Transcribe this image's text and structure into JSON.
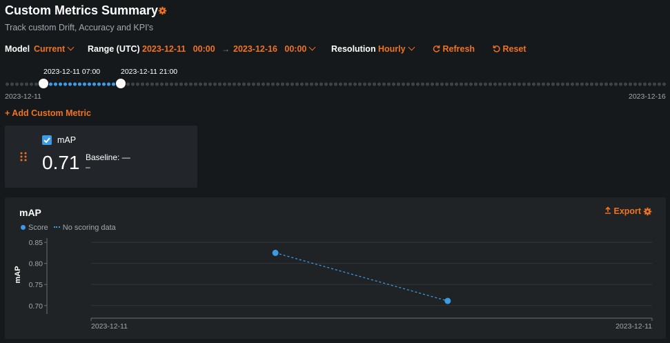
{
  "header": {
    "title": "Custom Metrics Summary",
    "subtitle": "Track custom Drift, Accuracy and KPI's",
    "settings_icon": "gear-icon"
  },
  "controls": {
    "model_label": "Model",
    "model_value": "Current",
    "range_label": "Range (UTC)",
    "range_start_date": "2023-12-11",
    "range_start_time": "00:00",
    "range_end_date": "2023-12-16",
    "range_end_time": "00:00",
    "resolution_label": "Resolution",
    "resolution_value": "Hourly",
    "refresh_label": "Refresh",
    "reset_label": "Reset"
  },
  "slider": {
    "start_label": "2023-12-11 07:00",
    "end_label": "2023-12-11 21:00",
    "min_label": "2023-12-11",
    "max_label": "2023-12-16",
    "selected_start_fraction": 0.058,
    "selected_end_fraction": 0.175
  },
  "add_metric_label": "+ Add Custom Metric",
  "metric_card": {
    "name": "mAP",
    "checked": true,
    "value": "0.71",
    "baseline_label": "Baseline:",
    "baseline_value": "—",
    "secondary_value": "–"
  },
  "chart_panel": {
    "title": "mAP",
    "export_label": "Export",
    "legend_score": "Score",
    "legend_no_data": "No scoring data"
  },
  "colors": {
    "accent": "#f0731f",
    "series": "#3b9be5",
    "background": "#16191c",
    "card": "#22262a"
  },
  "chart_data": {
    "type": "line",
    "title": "mAP",
    "xlabel": "",
    "ylabel": "mAP",
    "ylim": [
      0.68,
      0.86
    ],
    "y_ticks": [
      "0.85",
      "0.80",
      "0.75",
      "0.70"
    ],
    "x_tick_labels": [
      "2023-12-11",
      "2023-12-11"
    ],
    "x_range_hours": [
      0,
      14
    ],
    "series": [
      {
        "name": "Score",
        "x_hours": [
          4.6,
          8.9
        ],
        "values": [
          0.825,
          0.711
        ],
        "style": "dashed-connector"
      }
    ],
    "grid": true
  }
}
